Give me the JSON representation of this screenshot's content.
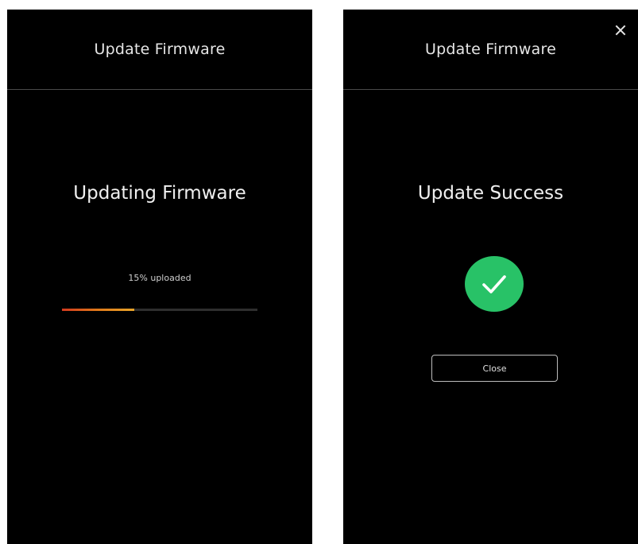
{
  "left_screen": {
    "header_title": "Update Firmware",
    "status_title": "Updating Firmware",
    "progress_text": "15% uploaded",
    "progress_percent": 37
  },
  "right_screen": {
    "header_title": "Update Firmware",
    "status_title": "Update Success",
    "close_label": "Close",
    "icons": {
      "close": "close-icon",
      "success": "checkmark-icon"
    }
  },
  "colors": {
    "background": "#000000",
    "success": "#28c267",
    "progress_start": "#d23a1e",
    "progress_end": "#e7a42a"
  }
}
